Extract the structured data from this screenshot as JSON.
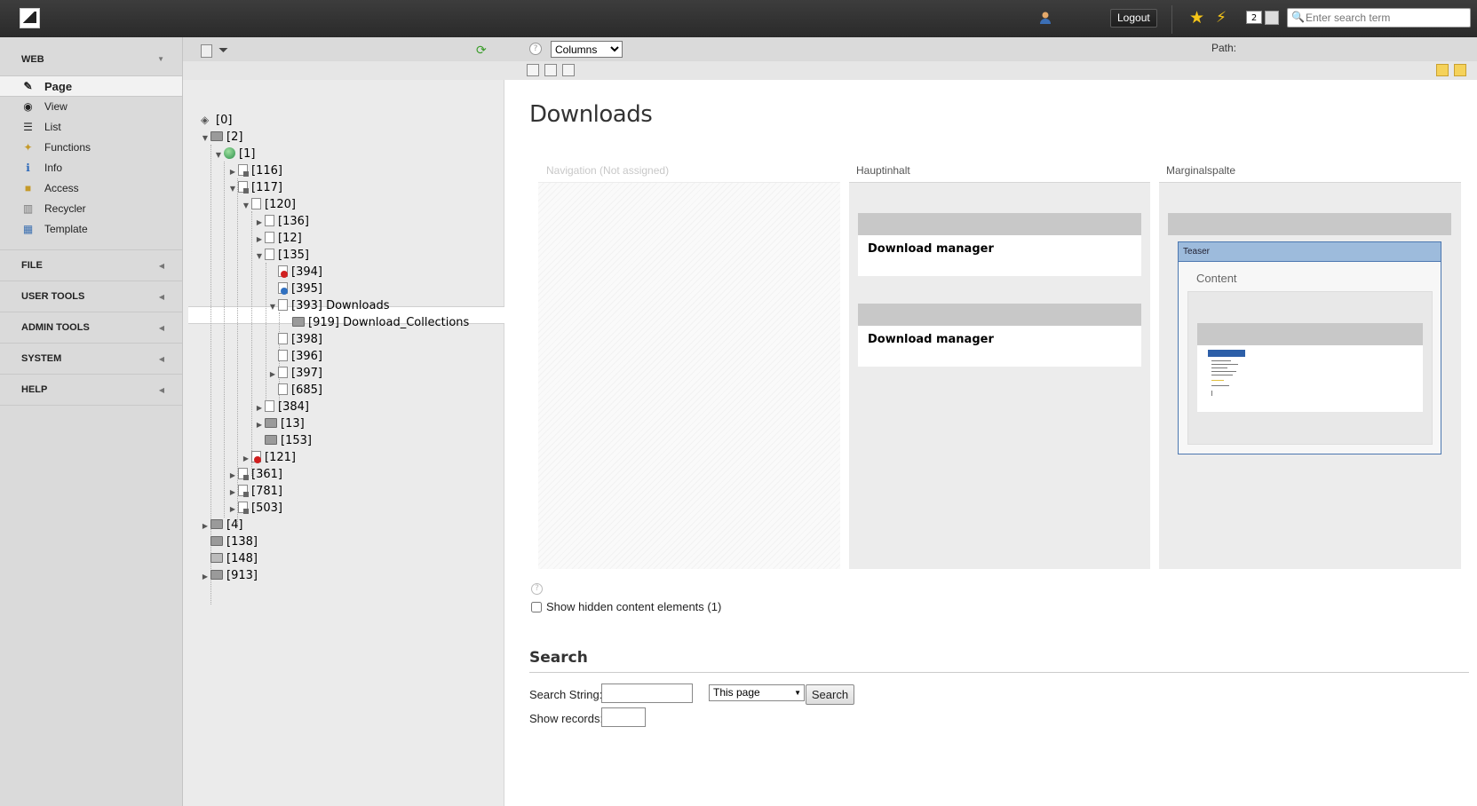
{
  "topbar": {
    "logout_label": "Logout",
    "badge_count": "2",
    "search_placeholder": "Enter search term",
    "icons": [
      "user-icon",
      "star-icon",
      "flash-icon",
      "edit-icon",
      "search-icon"
    ]
  },
  "modmenu": {
    "web": "WEB",
    "items": [
      {
        "label": "Page",
        "icon": "page-edit-icon",
        "symbol": "✎"
      },
      {
        "label": "View",
        "icon": "eye-icon",
        "symbol": "◉"
      },
      {
        "label": "List",
        "icon": "list-icon",
        "symbol": "☰"
      },
      {
        "label": "Functions",
        "icon": "wand-icon",
        "symbol": "✦"
      },
      {
        "label": "Info",
        "icon": "info-icon",
        "symbol": "ℹ"
      },
      {
        "label": "Access",
        "icon": "lock-icon",
        "symbol": "🔒"
      },
      {
        "label": "Recycler",
        "icon": "trash-icon",
        "symbol": "🗑"
      },
      {
        "label": "Template",
        "icon": "template-icon",
        "symbol": "▦"
      }
    ],
    "file": "FILE",
    "user_tools": "USER TOOLS",
    "admin_tools": "ADMIN TOOLS",
    "system": "SYSTEM",
    "help": "HELP"
  },
  "tree": {
    "nodes": [
      {
        "label": "[0]"
      },
      {
        "label": "[2]"
      },
      {
        "label": "[1]"
      },
      {
        "label": "[116]"
      },
      {
        "label": "[117]"
      },
      {
        "label": "[120]"
      },
      {
        "label": "[136]"
      },
      {
        "label": "[12]"
      },
      {
        "label": "[135]"
      },
      {
        "label": "[394]"
      },
      {
        "label": "[395]"
      },
      {
        "label": "[393] Downloads"
      },
      {
        "label": "[919] Download_Collections"
      },
      {
        "label": "[398]"
      },
      {
        "label": "[396]"
      },
      {
        "label": "[397]"
      },
      {
        "label": "[685]"
      },
      {
        "label": "[384]"
      },
      {
        "label": "[13]"
      },
      {
        "label": "[153]"
      },
      {
        "label": "[121]"
      },
      {
        "label": "[361]"
      },
      {
        "label": "[781]"
      },
      {
        "label": "[503]"
      },
      {
        "label": "[4]"
      },
      {
        "label": "[138]"
      },
      {
        "label": "[148]"
      },
      {
        "label": "[913]"
      }
    ]
  },
  "main": {
    "view_mode": "Columns",
    "path_label": "Path:",
    "page_title": "Downloads",
    "columns": {
      "nav": "Navigation (Not assigned)",
      "main": "Hauptinhalt",
      "side": "Marginalspalte"
    },
    "main_elements": [
      "Download manager",
      "Download manager"
    ],
    "teaser_label": "Teaser",
    "teaser_content_label": "Content",
    "show_hidden": "Show hidden content elements (1)",
    "search": {
      "heading": "Search",
      "string_label": "Search String:",
      "scope": "This page",
      "button": "Search",
      "records_label": "Show records:"
    }
  }
}
